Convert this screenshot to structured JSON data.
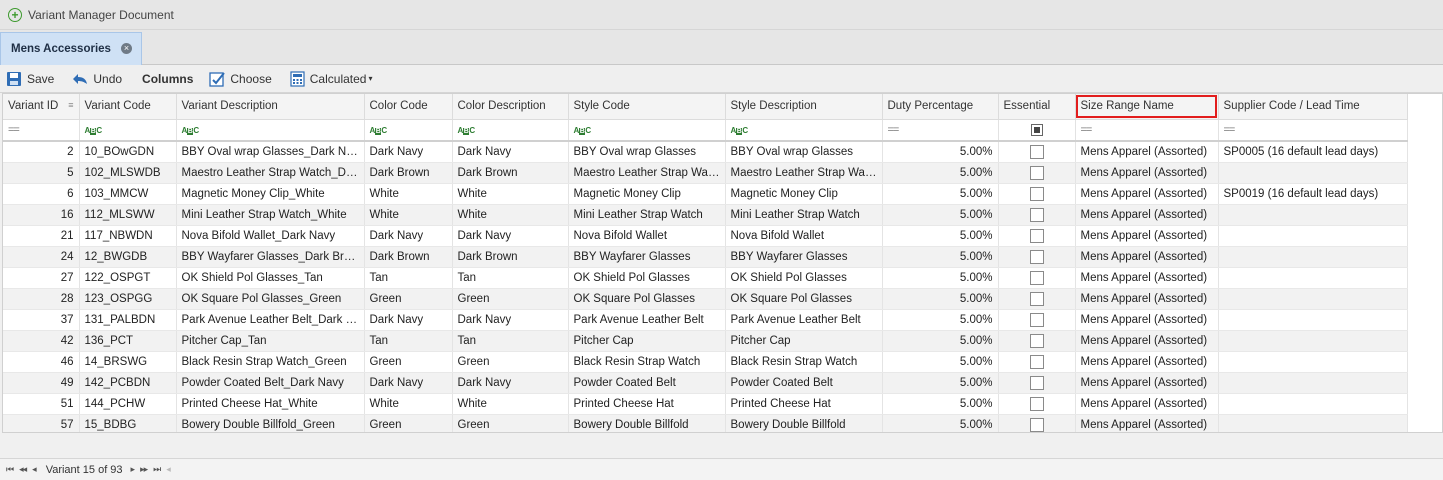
{
  "window": {
    "title": "Variant Manager Document"
  },
  "tab": {
    "label": "Mens Accessories"
  },
  "toolbar": {
    "save": "Save",
    "undo": "Undo",
    "columns": "Columns",
    "choose": "Choose",
    "calculated": "Calculated"
  },
  "columns": [
    "Variant ID",
    "Variant Code",
    "Variant Description",
    "Color Code",
    "Color Description",
    "Style Code",
    "Style Description",
    "Duty Percentage",
    "Essential",
    "Size Range Name",
    "Supplier Code / Lead Time"
  ],
  "rows": [
    [
      "2",
      "10_BOwGDN",
      "BBY Oval wrap Glasses_Dark Navy",
      "Dark Navy",
      "Dark Navy",
      "BBY Oval wrap Glasses",
      "BBY Oval wrap Glasses",
      "5.00%",
      "Mens Apparel (Assorted)",
      "SP0005 (16 default lead days)"
    ],
    [
      "5",
      "102_MLSWDB",
      "Maestro Leather Strap Watch_Dar...",
      "Dark Brown",
      "Dark Brown",
      "Maestro Leather Strap Watch",
      "Maestro Leather Strap Watch",
      "5.00%",
      "Mens Apparel (Assorted)",
      ""
    ],
    [
      "6",
      "103_MMCW",
      "Magnetic Money Clip_White",
      "White",
      "White",
      "Magnetic Money Clip",
      "Magnetic Money Clip",
      "5.00%",
      "Mens Apparel (Assorted)",
      "SP0019 (16 default lead days)"
    ],
    [
      "16",
      "112_MLSWW",
      "Mini Leather Strap Watch_White",
      "White",
      "White",
      "Mini Leather Strap Watch",
      "Mini Leather Strap Watch",
      "5.00%",
      "Mens Apparel (Assorted)",
      ""
    ],
    [
      "21",
      "117_NBWDN",
      "Nova Bifold Wallet_Dark Navy",
      "Dark Navy",
      "Dark Navy",
      "Nova Bifold Wallet",
      "Nova Bifold Wallet",
      "5.00%",
      "Mens Apparel (Assorted)",
      ""
    ],
    [
      "24",
      "12_BWGDB",
      "BBY Wayfarer Glasses_Dark Brown",
      "Dark Brown",
      "Dark Brown",
      "BBY Wayfarer Glasses",
      "BBY Wayfarer Glasses",
      "5.00%",
      "Mens Apparel (Assorted)",
      ""
    ],
    [
      "27",
      "122_OSPGT",
      "OK Shield Pol Glasses_Tan",
      "Tan",
      "Tan",
      "OK Shield Pol Glasses",
      "OK Shield Pol Glasses",
      "5.00%",
      "Mens Apparel (Assorted)",
      ""
    ],
    [
      "28",
      "123_OSPGG",
      "OK Square Pol Glasses_Green",
      "Green",
      "Green",
      "OK Square Pol Glasses",
      "OK Square Pol Glasses",
      "5.00%",
      "Mens Apparel (Assorted)",
      ""
    ],
    [
      "37",
      "131_PALBDN",
      "Park Avenue Leather Belt_Dark Na...",
      "Dark Navy",
      "Dark Navy",
      "Park Avenue Leather Belt",
      "Park Avenue Leather Belt",
      "5.00%",
      "Mens Apparel (Assorted)",
      ""
    ],
    [
      "42",
      "136_PCT",
      "Pitcher Cap_Tan",
      "Tan",
      "Tan",
      "Pitcher Cap",
      "Pitcher Cap",
      "5.00%",
      "Mens Apparel (Assorted)",
      ""
    ],
    [
      "46",
      "14_BRSWG",
      "Black Resin Strap Watch_Green",
      "Green",
      "Green",
      "Black Resin Strap Watch",
      "Black Resin Strap Watch",
      "5.00%",
      "Mens Apparel (Assorted)",
      ""
    ],
    [
      "49",
      "142_PCBDN",
      "Powder Coated Belt_Dark Navy",
      "Dark Navy",
      "Dark Navy",
      "Powder Coated Belt",
      "Powder Coated Belt",
      "5.00%",
      "Mens Apparel (Assorted)",
      ""
    ],
    [
      "51",
      "144_PCHW",
      "Printed Cheese Hat_White",
      "White",
      "White",
      "Printed Cheese Hat",
      "Printed Cheese Hat",
      "5.00%",
      "Mens Apparel (Assorted)",
      ""
    ],
    [
      "57",
      "15_BDBG",
      "Bowery Double Billfold_Green",
      "Green",
      "Green",
      "Bowery Double Billfold",
      "Bowery Double Billfold",
      "5.00%",
      "Mens Apparel (Assorted)",
      ""
    ]
  ],
  "footer": {
    "status": "Variant 15 of 93"
  },
  "colors": {
    "tab_bg": "#cfe1f5",
    "highlight": "#e21d1d",
    "accent": "#3e9a2e"
  }
}
